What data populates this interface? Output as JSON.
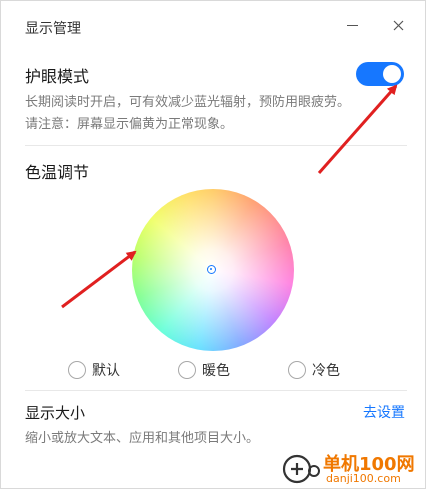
{
  "window": {
    "title": "显示管理"
  },
  "eye_mode": {
    "title": "护眼模式",
    "desc_line1": "长期阅读时开启，可有效减少蓝光辐射，预防用眼疲劳。",
    "desc_line2": "请注意：屏幕显示偏黄为正常现象。",
    "enabled": true
  },
  "color_temp": {
    "title": "色温调节",
    "options": [
      {
        "label": "默认",
        "selected": false
      },
      {
        "label": "暖色",
        "selected": false
      },
      {
        "label": "冷色",
        "selected": false
      }
    ]
  },
  "display_size": {
    "title": "显示大小",
    "link": "去设置",
    "desc": "缩小或放大文本、应用和其他项目大小。"
  },
  "watermark": {
    "brand": "单机100网",
    "site": "danji100.com"
  },
  "colors": {
    "accent": "#1677ff",
    "arrow": "#e02020"
  }
}
